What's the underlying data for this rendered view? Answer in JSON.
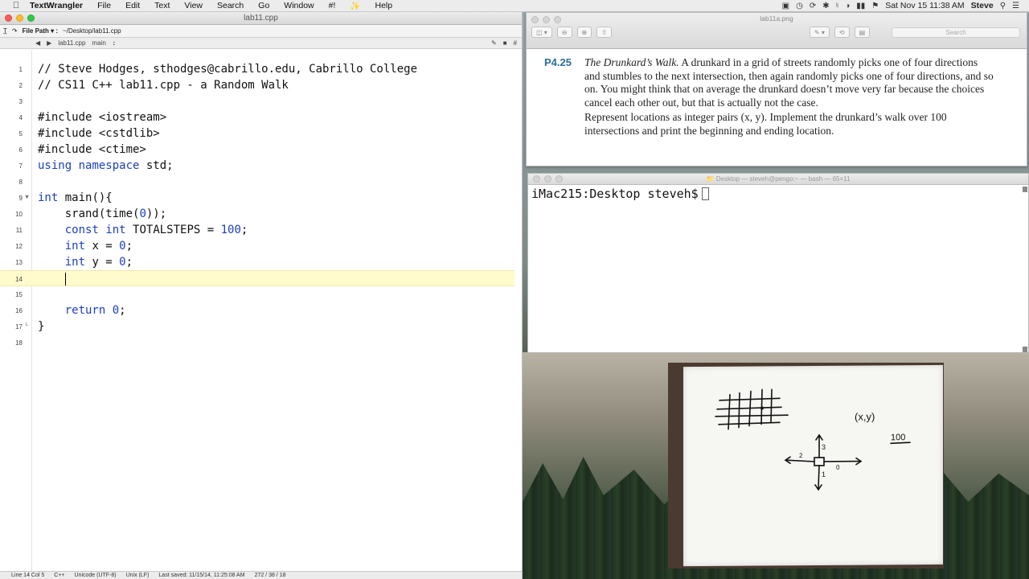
{
  "menubar": {
    "app_name": "TextWrangler",
    "items": [
      "File",
      "Edit",
      "Text",
      "View",
      "Search",
      "Go",
      "Window",
      "#!",
      "Help"
    ],
    "clock": "Sat Nov 15  11:38 AM",
    "user": "Steve"
  },
  "editor": {
    "window_title": "lab11.cpp",
    "toolbar_label": "File Path ▾ :",
    "toolbar_path": "~/Desktop/lab11.cpp",
    "nav_file": "lab11.cpp",
    "nav_function": "main",
    "lines": [
      {
        "num": "1",
        "text": "// Steve Hodges, sthodges@cabrillo.edu, Cabrillo College"
      },
      {
        "num": "2",
        "text": "// CS11 C++ lab11.cpp - a Random Walk"
      },
      {
        "num": "3",
        "text": ""
      },
      {
        "num": "4",
        "text": "#include <iostream>"
      },
      {
        "num": "5",
        "text": "#include <cstdlib>"
      },
      {
        "num": "6",
        "text": "#include <ctime>"
      },
      {
        "num": "7",
        "text": "using namespace std;"
      },
      {
        "num": "8",
        "text": ""
      },
      {
        "num": "9",
        "text": "int main(){"
      },
      {
        "num": "10",
        "text": "    srand(time(0));"
      },
      {
        "num": "11",
        "text": "    const int TOTALSTEPS = 100;"
      },
      {
        "num": "12",
        "text": "    int x = 0;"
      },
      {
        "num": "13",
        "text": "    int y = 0;"
      },
      {
        "num": "14",
        "text": "    "
      },
      {
        "num": "15",
        "text": ""
      },
      {
        "num": "16",
        "text": "    return 0;"
      },
      {
        "num": "17",
        "text": "}"
      },
      {
        "num": "18",
        "text": ""
      }
    ],
    "current_line": 14,
    "status": {
      "position": "Line 14 Col 5",
      "language": "C++",
      "encoding": "Unicode (UTF-8)",
      "line_endings": "Unix (LF)",
      "last_saved": "Last saved: 11/15/14, 11:25:08 AM",
      "counts": "272 / 38 / 18"
    }
  },
  "viewer": {
    "window_title": "lab11a.png",
    "search_placeholder": "Search",
    "problem_number": "P4.25",
    "problem_title": "The Drunkard’s Walk.",
    "paragraph1": " A drunkard in a grid of streets randomly picks one of four directions and stumbles to the next intersection, then again randomly picks one of four directions, and so on. You might think that on average the drunkard doesn’t move very far because the choices cancel each other out, but that is actually not the case.",
    "paragraph2": "Represent locations as integer pairs (x, y). Implement the drunkard’s walk over 100 intersections and print the beginning and ending location."
  },
  "terminal": {
    "window_title": "Desktop — steveh@pengo:~ — bash — 65×11",
    "prompt": "iMac215:Desktop steveh$"
  },
  "whiteboard": {
    "label_xy": "(x,y)",
    "label_100": "100",
    "dir_up": "3",
    "dir_left": "2",
    "dir_down": "1",
    "dir_right": "0"
  },
  "colors": {
    "current_line_highlight": "#fffbcc",
    "keyword": "#1c3fbf",
    "problem_number": "#2a6f97"
  }
}
